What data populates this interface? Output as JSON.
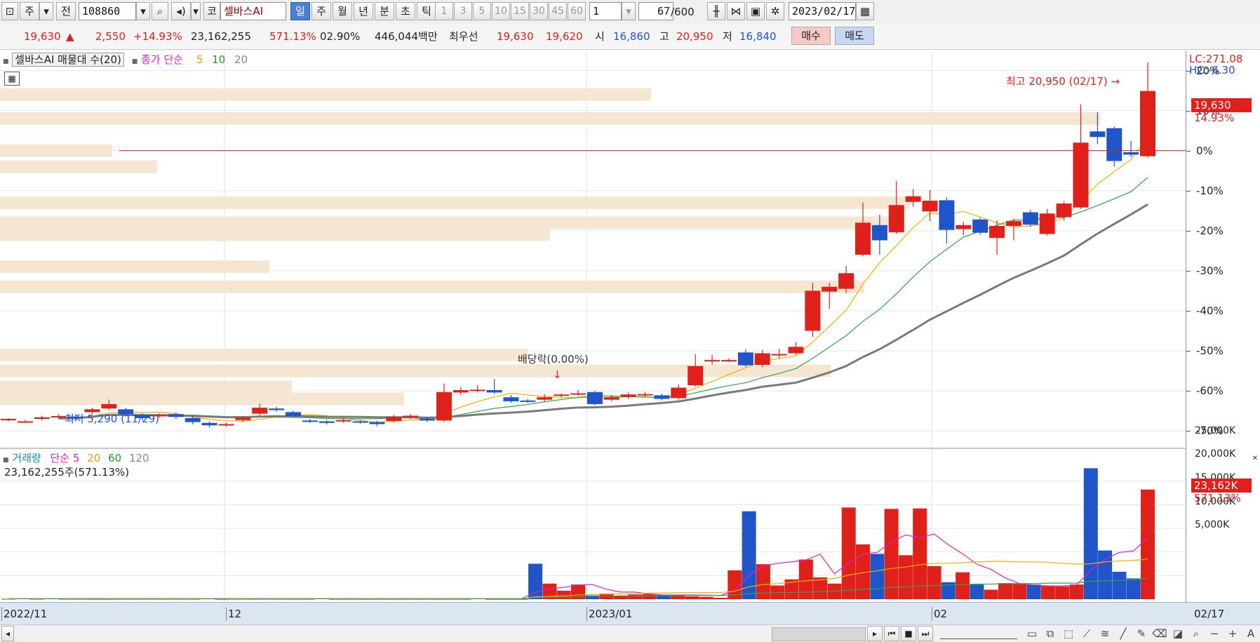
{
  "toolbar": {
    "market_btn": "주",
    "prev_btn": "전",
    "code_value": "108860",
    "kospi_btn": "코",
    "stock_name": "셀바스AI",
    "periods": [
      "일",
      "주",
      "월",
      "년",
      "분",
      "초",
      "틱"
    ],
    "selected_period": "일",
    "minute_options": [
      "1",
      "3",
      "5",
      "10",
      "15",
      "30",
      "45",
      "60"
    ],
    "unit_value": "1",
    "count_value": "67",
    "count_max": "/600",
    "date_value": "2023/02/17"
  },
  "quote": {
    "price": "19,630",
    "change": "2,550",
    "change_pct": "+14.93%",
    "volume": "23,162,255",
    "vol_ratio": "571.13%",
    "turnover_ratio": "02.90%",
    "amount": "446,044백만",
    "best_label": "최우선",
    "ask": "19,630",
    "bid": "19,620",
    "open_label": "시",
    "open": "16,860",
    "high_label": "고",
    "high": "20,950",
    "low_label": "저",
    "low": "16,840",
    "buy_btn": "매수",
    "sell_btn": "매도"
  },
  "price_legend": {
    "vp_label": "셀바스AI 매물대 수(20)",
    "ma_label": "종가 단순",
    "ma5": "5",
    "ma10": "10",
    "ma20": "20"
  },
  "price_annotations": {
    "high_marker": "최고 20,950 (02/17)",
    "low_marker": "최저 5,290 (11/29)",
    "dividend_marker": "배당락(0.00%)",
    "lc": "LC:271.08",
    "hc": "HC:-6.30",
    "last_price_tag": "19,630",
    "last_pct_tag": "14.93%"
  },
  "price_axis_ticks": [
    "20%",
    "10%",
    "0%",
    "-10%",
    "-20%",
    "-30%",
    "-40%",
    "-50%",
    "-60%",
    "-70%"
  ],
  "volume_legend": {
    "label": "거래량",
    "ma_label": "단순",
    "ma5": "5",
    "ma20": "20",
    "ma60": "60",
    "ma120": "120",
    "value": "23,162,255주(571.13%)"
  },
  "volume_axis_ticks": [
    "25,000K",
    "20,000K",
    "15,000K",
    "10,000K",
    "5,000K"
  ],
  "volume_tags": {
    "vol": "23,162K",
    "pct": "571.13%"
  },
  "x_axis": {
    "labels": [
      "2022/11",
      "12",
      "2023/01",
      "02"
    ],
    "last_date": "02/17"
  },
  "colors": {
    "up": "#e0201a",
    "down": "#1f55c8",
    "ma5": "#f0b000",
    "ma10": "#2aa845",
    "ma20": "#7a7a7a",
    "vol_ma5": "#e020d0",
    "volume_profile": "#f5e6d2"
  },
  "chart_data": [
    {
      "type": "candlestick",
      "title": "셀바스AI",
      "ylabel": "%",
      "ylim": [
        -74,
        25
      ],
      "candles_pct": [
        {
          "o": -67.2,
          "c": -67.0,
          "h": -66.8,
          "l": -67.6
        },
        {
          "o": -67.8,
          "c": -67.6,
          "h": -67.2,
          "l": -68.0
        },
        {
          "o": -67.0,
          "c": -66.6,
          "h": -66.2,
          "l": -67.4
        },
        {
          "o": -66.6,
          "c": -66.3,
          "h": -65.8,
          "l": -67.0
        },
        {
          "o": -66.4,
          "c": -66.7,
          "h": -66.0,
          "l": -67.2
        },
        {
          "o": -65.3,
          "c": -64.6,
          "h": -64.2,
          "l": -65.8
        },
        {
          "o": -64.4,
          "c": -63.3,
          "h": -62.2,
          "l": -64.8
        },
        {
          "o": -64.6,
          "c": -65.8,
          "h": -64.2,
          "l": -66.4
        },
        {
          "o": -66.0,
          "c": -66.8,
          "h": -65.6,
          "l": -67.4
        },
        {
          "o": -66.3,
          "c": -66.0,
          "h": -65.6,
          "l": -66.8
        },
        {
          "o": -65.8,
          "c": -66.5,
          "h": -65.4,
          "l": -67.0
        },
        {
          "o": -66.8,
          "c": -67.8,
          "h": -66.4,
          "l": -68.4
        },
        {
          "o": -68.0,
          "c": -68.6,
          "h": -67.6,
          "l": -69.2
        },
        {
          "o": -68.6,
          "c": -68.3,
          "h": -67.9,
          "l": -69.0
        },
        {
          "o": -67.3,
          "c": -66.7,
          "h": -66.3,
          "l": -67.7
        },
        {
          "o": -65.7,
          "c": -64.2,
          "h": -63.2,
          "l": -66.1
        },
        {
          "o": -64.4,
          "c": -64.8,
          "h": -64.0,
          "l": -65.2
        },
        {
          "o": -65.3,
          "c": -66.3,
          "h": -64.9,
          "l": -66.7
        },
        {
          "o": -67.4,
          "c": -67.7,
          "h": -67.0,
          "l": -68.0
        },
        {
          "o": -67.6,
          "c": -68.0,
          "h": -67.3,
          "l": -68.4
        },
        {
          "o": -67.6,
          "c": -67.3,
          "h": -67.0,
          "l": -68.0
        },
        {
          "o": -67.6,
          "c": -67.8,
          "h": -67.3,
          "l": -68.2
        },
        {
          "o": -67.8,
          "c": -68.3,
          "h": -67.4,
          "l": -68.8
        },
        {
          "o": -67.5,
          "c": -66.5,
          "h": -66.0,
          "l": -67.9
        },
        {
          "o": -66.6,
          "c": -66.2,
          "h": -65.8,
          "l": -67.0
        },
        {
          "o": -67.0,
          "c": -67.4,
          "h": -66.6,
          "l": -67.8
        },
        {
          "o": -67.4,
          "c": -60.3,
          "h": -58.2,
          "l": -67.8
        },
        {
          "o": -60.4,
          "c": -59.8,
          "h": -59.0,
          "l": -61.0
        },
        {
          "o": -60.0,
          "c": -59.7,
          "h": -58.6,
          "l": -60.4
        },
        {
          "o": -59.8,
          "c": -60.4,
          "h": -57.0,
          "l": -60.8
        },
        {
          "o": -61.6,
          "c": -62.6,
          "h": -61.0,
          "l": -63.0
        },
        {
          "o": -62.4,
          "c": -62.7,
          "h": -62.0,
          "l": -63.0
        },
        {
          "o": -62.2,
          "c": -61.6,
          "h": -60.8,
          "l": -62.6
        },
        {
          "o": -61.0,
          "c": -60.9,
          "h": -60.6,
          "l": -61.6
        },
        {
          "o": -60.8,
          "c": -60.6,
          "h": -59.8,
          "l": -61.2
        },
        {
          "o": -60.3,
          "c": -63.3,
          "h": -60.0,
          "l": -63.6
        },
        {
          "o": -62.2,
          "c": -61.6,
          "h": -61.0,
          "l": -62.6
        },
        {
          "o": -61.5,
          "c": -60.9,
          "h": -60.4,
          "l": -62.0
        },
        {
          "o": -61.0,
          "c": -60.8,
          "h": -60.2,
          "l": -61.6
        },
        {
          "o": -61.1,
          "c": -62.0,
          "h": -60.7,
          "l": -62.4
        },
        {
          "o": -61.8,
          "c": -59.2,
          "h": -58.4,
          "l": -62.2
        },
        {
          "o": -58.6,
          "c": -53.8,
          "h": -50.8,
          "l": -59.0
        },
        {
          "o": -52.6,
          "c": -52.3,
          "h": -51.0,
          "l": -53.4
        },
        {
          "o": -52.5,
          "c": -52.3,
          "h": -51.9,
          "l": -52.8
        },
        {
          "o": -50.4,
          "c": -53.6,
          "h": -49.6,
          "l": -54.0
        },
        {
          "o": -53.5,
          "c": -50.6,
          "h": -49.8,
          "l": -54.1
        },
        {
          "o": -51.0,
          "c": -50.8,
          "h": -49.5,
          "l": -51.8
        },
        {
          "o": -50.6,
          "c": -49.0,
          "h": -47.8,
          "l": -51.0
        },
        {
          "o": -45.0,
          "c": -35.0,
          "h": -33.0,
          "l": -46.5
        },
        {
          "o": -35.2,
          "c": -34.0,
          "h": -33.0,
          "l": -39.5
        },
        {
          "o": -34.5,
          "c": -30.6,
          "h": -28.8,
          "l": -35.6
        },
        {
          "o": -26.0,
          "c": -18.0,
          "h": -13.0,
          "l": -26.4
        },
        {
          "o": -18.6,
          "c": -22.4,
          "h": -16.0,
          "l": -26.0
        },
        {
          "o": -20.4,
          "c": -13.6,
          "h": -7.6,
          "l": -20.8
        },
        {
          "o": -12.8,
          "c": -11.4,
          "h": -9.6,
          "l": -14.0
        },
        {
          "o": -15.2,
          "c": -12.5,
          "h": -9.8,
          "l": -17.6
        },
        {
          "o": -12.4,
          "c": -19.8,
          "h": -11.6,
          "l": -23.2
        },
        {
          "o": -19.6,
          "c": -18.6,
          "h": -17.8,
          "l": -21.2
        },
        {
          "o": -17.2,
          "c": -20.5,
          "h": -16.8,
          "l": -21.0
        },
        {
          "o": -21.8,
          "c": -18.8,
          "h": -17.4,
          "l": -26.0
        },
        {
          "o": -18.8,
          "c": -17.6,
          "h": -17.0,
          "l": -22.4
        },
        {
          "o": -15.4,
          "c": -18.5,
          "h": -14.8,
          "l": -19.0
        },
        {
          "o": -20.8,
          "c": -15.7,
          "h": -14.6,
          "l": -21.2
        },
        {
          "o": -16.6,
          "c": -13.2,
          "h": -12.6,
          "l": -17.4
        },
        {
          "o": -14.2,
          "c": 2.0,
          "h": 11.6,
          "l": -14.6
        },
        {
          "o": 4.8,
          "c": 3.4,
          "h": 9.6,
          "l": 1.6
        },
        {
          "o": 5.6,
          "c": -2.6,
          "h": 6.0,
          "l": -4.0
        },
        {
          "o": -0.4,
          "c": -1.0,
          "h": 2.4,
          "l": -1.6
        },
        {
          "o": -1.4,
          "c": 14.9,
          "h": 22.0,
          "l": -1.8
        }
      ],
      "last_close": "19,630",
      "period_high": "20,950",
      "period_low": "5,290"
    },
    {
      "type": "bar",
      "title": "거래량",
      "ylabel": "K",
      "ylim": [
        0,
        28500
      ],
      "values_k": [
        90,
        150,
        80,
        150,
        80,
        80,
        70,
        70,
        80,
        80,
        80,
        80,
        80,
        80,
        140,
        60,
        80,
        80,
        80,
        80,
        80,
        70,
        220,
        70,
        70,
        70,
        70,
        70,
        70,
        70,
        70,
        70,
        70,
        180,
        60,
        60,
        60,
        7500,
        3300,
        1800,
        3100,
        800,
        1200,
        700,
        1000,
        1100,
        900,
        900,
        600,
        500,
        300,
        6100,
        18600,
        7400,
        2900,
        4200,
        8400,
        4600,
        3300,
        19400,
        11600,
        9600,
        19100,
        9300,
        19200,
        7000,
        3600,
        5700,
        3100,
        2000,
        3400,
        3200,
        3100,
        2800,
        2700,
        3100,
        27700,
        10300,
        5800,
        4400,
        23200
      ],
      "ma5_k": [
        80,
        80,
        80,
        80,
        80,
        80,
        80,
        80,
        80,
        80,
        80,
        80,
        80,
        80,
        80,
        80,
        80,
        80,
        80,
        80,
        80,
        80,
        80,
        80,
        80,
        80,
        80,
        80,
        80,
        80,
        80,
        80,
        80,
        80,
        80,
        80,
        80,
        1500,
        2200,
        2500,
        3000,
        3100,
        2100,
        1500,
        1500,
        1100,
        900,
        900,
        900,
        850,
        800,
        1800,
        5100,
        7000,
        7600,
        7900,
        8300,
        9500,
        5400,
        7600,
        9600,
        9900,
        12100,
        13600,
        13000,
        13800,
        11500,
        9600,
        7400,
        6300,
        4500,
        3300,
        3000,
        2800,
        2800,
        3000,
        6100,
        8400,
        9900,
        10200,
        13000
      ],
      "ma20_k": [
        120,
        120,
        120,
        120,
        120,
        120,
        120,
        120,
        120,
        120,
        120,
        120,
        120,
        120,
        120,
        120,
        120,
        120,
        120,
        120,
        120,
        120,
        120,
        120,
        120,
        120,
        120,
        120,
        120,
        120,
        120,
        120,
        120,
        120,
        120,
        120,
        120,
        500,
        600,
        700,
        900,
        1000,
        1100,
        1100,
        1200,
        1300,
        1300,
        1400,
        1400,
        1400,
        1400,
        1700,
        2600,
        3100,
        3300,
        3600,
        3900,
        4100,
        4400,
        5100,
        5600,
        6000,
        6500,
        6800,
        7300,
        7600,
        7600,
        7700,
        7900,
        8000,
        8000,
        7900,
        7900,
        7800,
        7600,
        7400,
        7500,
        7900,
        8100,
        8200,
        8500
      ],
      "ma60_k": [
        100,
        100,
        100,
        100,
        100,
        100,
        100,
        100,
        100,
        100,
        100,
        100,
        100,
        100,
        100,
        100,
        100,
        100,
        100,
        100,
        100,
        100,
        100,
        100,
        100,
        100,
        100,
        100,
        100,
        100,
        100,
        100,
        100,
        100,
        100,
        100,
        100,
        300,
        400,
        500,
        500,
        600,
        600,
        700,
        700,
        700,
        800,
        800,
        800,
        800,
        800,
        900,
        1200,
        1300,
        1400,
        1400,
        1500,
        1600,
        1700,
        1900,
        2100,
        2200,
        2500,
        2600,
        2800,
        2900,
        3000,
        3100,
        3200,
        3200,
        3300,
        3300,
        3300,
        3400,
        3400,
        3400,
        3800,
        3900,
        4000,
        4100,
        4400
      ]
    }
  ]
}
